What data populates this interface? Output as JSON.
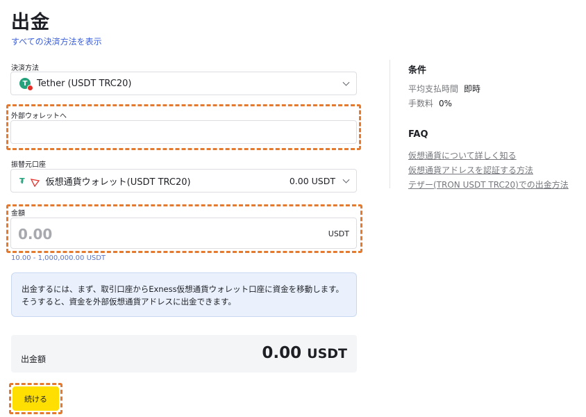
{
  "page": {
    "title": "出金",
    "all_methods_link": "すべての決済方法を表示"
  },
  "payment_method": {
    "label": "決済方法",
    "value": "Tether (USDT TRC20)",
    "coin_glyph": "T"
  },
  "external_wallet": {
    "label": "外部ウォレットへ",
    "value": "",
    "placeholder": ""
  },
  "source_account": {
    "label": "振替元口座",
    "value": "仮想通貨ウォレット(USDT TRC20)",
    "balance": "0.00 USDT"
  },
  "amount": {
    "label": "金額",
    "placeholder": "0.00",
    "currency": "USDT",
    "range": "10.00 - 1,000,000.00 USDT"
  },
  "info_text": "出金するには、まず、取引口座からExness仮想通貨ウォレット口座に資金を移動します。そうすると、資金を外部仮想通貨アドレスに出金できます。",
  "summary": {
    "label": "出金額",
    "value": "0.00",
    "currency": "USDT"
  },
  "continue_button": "続ける",
  "conditions": {
    "title": "条件",
    "rows": [
      {
        "label": "平均支払時間",
        "value": "即時"
      },
      {
        "label": "手数料",
        "value": "0%"
      }
    ]
  },
  "faq": {
    "title": "FAQ",
    "links": [
      "仮想通貨について詳しく知る",
      "仮想通貨アドレスを認証する方法",
      "テザー(TRON USDT TRC20)での出金方法"
    ]
  },
  "colors": {
    "accent_yellow": "#ffde02",
    "highlight_orange": "#e47a2e",
    "link_blue": "#3b5fd9",
    "tether_green": "#26a17b",
    "tron_red": "#e5302a"
  }
}
